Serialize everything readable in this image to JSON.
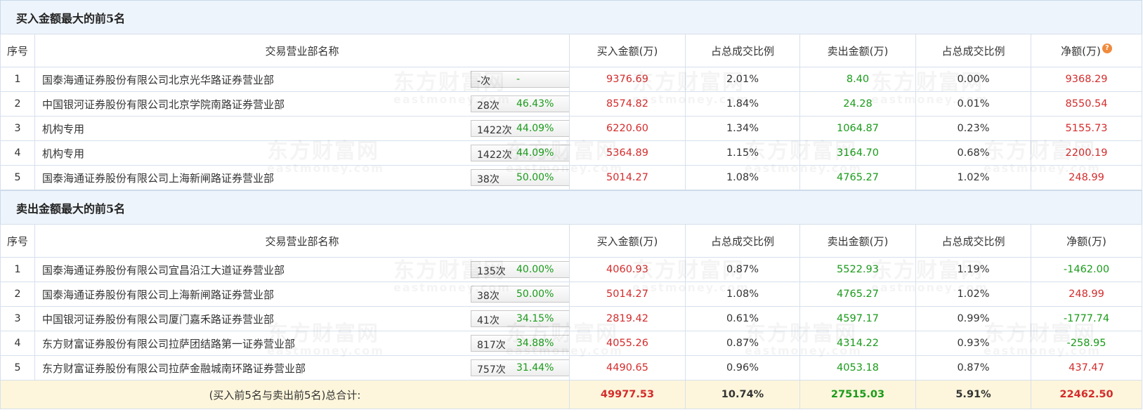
{
  "watermark": {
    "cn": "东方财富网",
    "en": "eastmoney.com"
  },
  "headers": {
    "idx": "序号",
    "name": "交易营业部名称",
    "buy": "买入金额(万)",
    "buy_pct": "占总成交比例",
    "sell": "卖出金额(万)",
    "sell_pct": "占总成交比例",
    "net": "净额(万)"
  },
  "buy_section": {
    "title": "买入金额最大的前5名",
    "rows": [
      {
        "idx": "1",
        "name": "国泰海通证券股份有限公司北京光华路证券营业部",
        "count": "-次",
        "rate": "-",
        "has_help": true,
        "buy": "9376.69",
        "buy_pct": "2.01%",
        "sell": "8.40",
        "sell_pct": "0.00%",
        "net": "9368.29",
        "net_color": "red"
      },
      {
        "idx": "2",
        "name": "中国银河证券股份有限公司北京学院南路证券营业部",
        "count": "28次",
        "rate": "46.43%",
        "has_help": false,
        "buy": "8574.82",
        "buy_pct": "1.84%",
        "sell": "24.28",
        "sell_pct": "0.01%",
        "net": "8550.54",
        "net_color": "red"
      },
      {
        "idx": "3",
        "name": "机构专用",
        "count": "1422次",
        "rate": "44.09%",
        "has_help": false,
        "buy": "6220.60",
        "buy_pct": "1.34%",
        "sell": "1064.87",
        "sell_pct": "0.23%",
        "net": "5155.73",
        "net_color": "red"
      },
      {
        "idx": "4",
        "name": "机构专用",
        "count": "1422次",
        "rate": "44.09%",
        "has_help": false,
        "buy": "5364.89",
        "buy_pct": "1.15%",
        "sell": "3164.70",
        "sell_pct": "0.68%",
        "net": "2200.19",
        "net_color": "red"
      },
      {
        "idx": "5",
        "name": "国泰海通证券股份有限公司上海新闸路证券营业部",
        "count": "38次",
        "rate": "50.00%",
        "has_help": false,
        "buy": "5014.27",
        "buy_pct": "1.08%",
        "sell": "4765.27",
        "sell_pct": "1.02%",
        "net": "248.99",
        "net_color": "red"
      }
    ]
  },
  "sell_section": {
    "title": "卖出金额最大的前5名",
    "rows": [
      {
        "idx": "1",
        "name": "国泰海通证券股份有限公司宜昌沿江大道证券营业部",
        "count": "135次",
        "rate": "40.00%",
        "has_help": true,
        "buy": "4060.93",
        "buy_pct": "0.87%",
        "sell": "5522.93",
        "sell_pct": "1.19%",
        "net": "-1462.00",
        "net_color": "green"
      },
      {
        "idx": "2",
        "name": "国泰海通证券股份有限公司上海新闸路证券营业部",
        "count": "38次",
        "rate": "50.00%",
        "has_help": false,
        "buy": "5014.27",
        "buy_pct": "1.08%",
        "sell": "4765.27",
        "sell_pct": "1.02%",
        "net": "248.99",
        "net_color": "red"
      },
      {
        "idx": "3",
        "name": "中国银河证券股份有限公司厦门嘉禾路证券营业部",
        "count": "41次",
        "rate": "34.15%",
        "has_help": false,
        "buy": "2819.42",
        "buy_pct": "0.61%",
        "sell": "4597.17",
        "sell_pct": "0.99%",
        "net": "-1777.74",
        "net_color": "green"
      },
      {
        "idx": "4",
        "name": "东方财富证券股份有限公司拉萨团结路第一证券营业部",
        "count": "817次",
        "rate": "34.88%",
        "has_help": false,
        "buy": "4055.26",
        "buy_pct": "0.87%",
        "sell": "4314.22",
        "sell_pct": "0.93%",
        "net": "-258.95",
        "net_color": "green"
      },
      {
        "idx": "5",
        "name": "东方财富证券股份有限公司拉萨金融城南环路证券营业部",
        "count": "757次",
        "rate": "31.44%",
        "has_help": false,
        "buy": "4490.65",
        "buy_pct": "0.96%",
        "sell": "4053.18",
        "sell_pct": "0.87%",
        "net": "437.47",
        "net_color": "red"
      }
    ]
  },
  "total": {
    "label": "(买入前5名与卖出前5名)总合计:",
    "buy": "49977.53",
    "buy_pct": "10.74%",
    "sell": "27515.03",
    "sell_pct": "5.91%",
    "net": "22462.50"
  },
  "help_glyph": "?",
  "colors": {
    "red": "#d42c2c",
    "green": "#1a9b1a",
    "header_bg": "#eef4fb",
    "total_bg": "#fdf6dc",
    "help_badge": "#f08a3c"
  }
}
